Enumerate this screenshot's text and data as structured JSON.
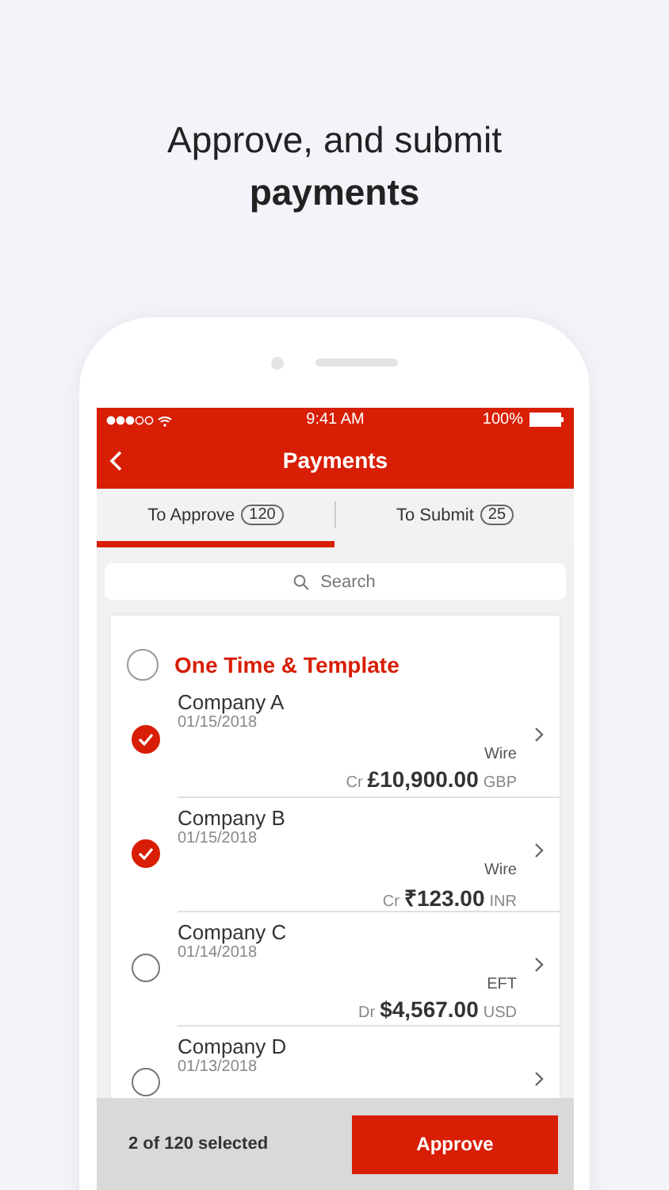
{
  "headline": {
    "line_1": "Approve, and submit",
    "line_2": "payments"
  },
  "status_bar": {
    "time": "9:41 AM",
    "battery": "100%"
  },
  "nav_bar": {
    "title": "Payments"
  },
  "tabs": [
    {
      "label": "To Approve",
      "count": "120",
      "selected": true
    },
    {
      "label": "To Submit",
      "count": "25",
      "selected": false
    }
  ],
  "search": {
    "placeholder": "Search"
  },
  "group": {
    "title": "One Time & Template",
    "checked": false
  },
  "payments": [
    {
      "name": "Company A",
      "date": "01/15/2018",
      "type": "Wire",
      "direction": "Cr",
      "amount": "£10,900.00",
      "currency": "GBP",
      "checked": true
    },
    {
      "name": "Company B",
      "date": "01/15/2018",
      "type": "Wire",
      "direction": "Cr",
      "amount": "₹123.00",
      "currency": "INR",
      "checked": true
    },
    {
      "name": "Company C",
      "date": "01/14/2018",
      "type": "EFT",
      "direction": "Dr",
      "amount": "$4,567.00",
      "currency": "USD",
      "checked": false
    },
    {
      "name": "Company D",
      "date": "01/13/2018",
      "checked": false
    }
  ],
  "footer": {
    "selection": "2 of 120 selected",
    "button": "Approve"
  }
}
